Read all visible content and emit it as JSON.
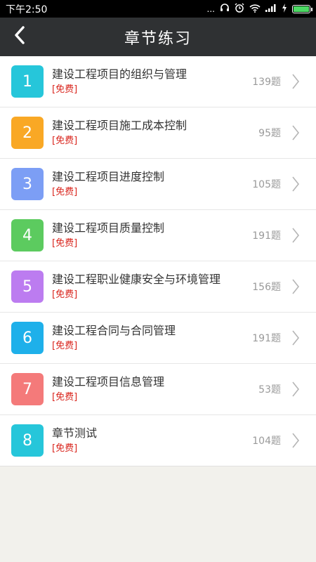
{
  "status_bar": {
    "time": "下午2:50",
    "dots": "..."
  },
  "header": {
    "title": "章节练习"
  },
  "chapters": [
    {
      "num": "1",
      "title": "建设工程项目的组织与管理",
      "tag": "[免费]",
      "count": "139题",
      "color": "#26c6da"
    },
    {
      "num": "2",
      "title": "建设工程项目施工成本控制",
      "tag": "[免费]",
      "count": "95题",
      "color": "#f9a825"
    },
    {
      "num": "3",
      "title": "建设工程项目进度控制",
      "tag": "[免费]",
      "count": "105题",
      "color": "#7c9ef5"
    },
    {
      "num": "4",
      "title": "建设工程项目质量控制",
      "tag": "[免费]",
      "count": "191题",
      "color": "#5ccb5f"
    },
    {
      "num": "5",
      "title": "建设工程职业健康安全与环境管理",
      "tag": "[免费]",
      "count": "156题",
      "color": "#bc7cf0"
    },
    {
      "num": "6",
      "title": "建设工程合同与合同管理",
      "tag": "[免费]",
      "count": "191题",
      "color": "#1eb0ea"
    },
    {
      "num": "7",
      "title": "建设工程项目信息管理",
      "tag": "[免费]",
      "count": "53题",
      "color": "#f47a7a"
    },
    {
      "num": "8",
      "title": "章节测试",
      "tag": "[免费]",
      "count": "104题",
      "color": "#26c6da"
    }
  ],
  "icons": [
    "back-arrow-icon",
    "chevron-right-icon",
    "headset-icon",
    "alarm-icon",
    "wifi-icon",
    "signal-icon",
    "charging-icon",
    "battery-icon"
  ]
}
